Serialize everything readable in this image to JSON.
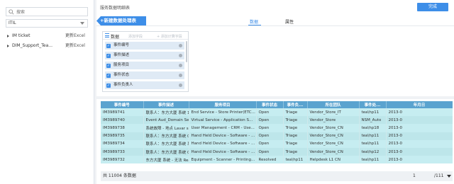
{
  "sidebar": {
    "search_placeholder": "搜索",
    "dropdown_value": "ITIL",
    "items": [
      {
        "name": "IM ticket",
        "status": "更新Excel"
      },
      {
        "name": "DIM_Support_Tea...",
        "status": "更新Excel"
      }
    ]
  },
  "header": {
    "title": "服务数据明细表",
    "done_label": "完成"
  },
  "toolbar": {
    "new_table_label": "+新建数据处理表"
  },
  "tabs": [
    {
      "label": "数据"
    },
    {
      "label": "属性"
    }
  ],
  "fields_panel": {
    "title": "数据",
    "tool1": "添加字段",
    "tool2": "+ 添加计算字段",
    "fields": [
      "事件编号",
      "事件描述",
      "服务项目",
      "事件状态",
      "事件负责人"
    ]
  },
  "table": {
    "columns": [
      "事件编号",
      "事件描述",
      "服务项目",
      "事件状态",
      "事件负...",
      "所在团队",
      "事件处...",
      "年月日"
    ],
    "rows": [
      [
        "IM3989741",
        "联系人：东方大厦 系统 1580...",
        "End Service - Store Printer(ETC...",
        "Open",
        "Triage",
        "Vendor_Store_IT",
        "tea\\hp11",
        "2013-0"
      ],
      [
        "IM3989740",
        "Event Aud_Domain Server...",
        "Virtual Service - Application S...",
        "Open",
        "Triage",
        "Vendor_Store",
        "NSM_Auto",
        "2013-0"
      ],
      [
        "IM3989738",
        "系统故障 - 地点 Lavar sopport sys...",
        "User Management - CRM - Use...",
        "Open",
        "Triage",
        "Vendor_Store_CN",
        "tea\\hp18",
        "2013-0"
      ],
      [
        "IM3989735",
        "联系人：东方大厦 系统 022-...",
        "Hand Held Device - Software - ...",
        "Open",
        "Triage",
        "Vendor_Store_CN",
        "tea\\hp11",
        "2013-0"
      ],
      [
        "IM3989734",
        "联系人：东方大厦 系统 系统 022-...",
        "Hand Held Device - Software - ...",
        "Open",
        "Triage",
        "Vendor_Store_CN",
        "tea\\hp11",
        "2013-0"
      ],
      [
        "IM3989733",
        "联系人：东方大厦 系统 022-...",
        "Hand Held Device - Software - ...",
        "Open",
        "Triage",
        "Vendor_Store_CN",
        "tea\\hp12",
        "2013-0"
      ],
      [
        "IM3989732",
        "东方大厦 系统 - 无法 Read...",
        "Equipment - Scanner - Printing...",
        "Resolved",
        "tea\\hp11",
        "Helpdesk L1 CN",
        "tea\\hp11",
        "2013-0"
      ]
    ]
  },
  "footer": {
    "count": "共 11004 条数据",
    "page": "1",
    "total": "/111"
  },
  "colors": {
    "accent": "#3d8ee8",
    "header_bg": "#5aa3cf",
    "row_bg": "#c6edf1"
  }
}
